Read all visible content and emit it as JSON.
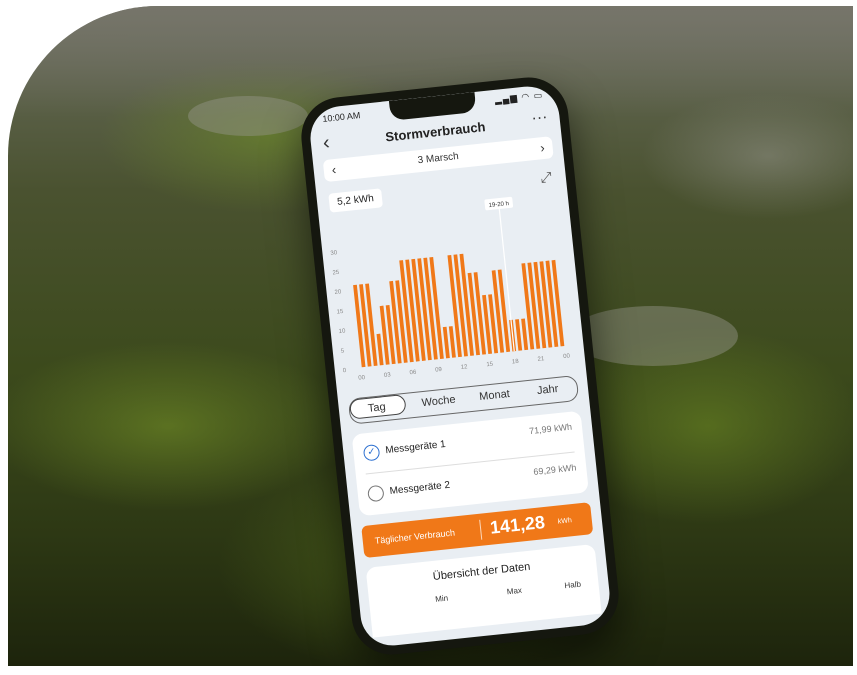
{
  "status": {
    "time": "10:00 AM",
    "icons": "▂▄▆ ◠ ▭"
  },
  "header": {
    "back_icon": "‹",
    "title": "Stormverbrauch",
    "more_icon": "···"
  },
  "date_nav": {
    "prev_icon": "‹",
    "date": "3 Marsch",
    "next_icon": "›"
  },
  "selected_value": "5,2 kWh",
  "expand_icon": "⤢",
  "chart_data": {
    "type": "bar",
    "tooltip": "19-20 h",
    "y_ticks": [
      "0",
      "5",
      "10",
      "15",
      "20",
      "25",
      "30"
    ],
    "x_ticks": [
      "00",
      "03",
      "06",
      "09",
      "12",
      "15",
      "18",
      "21",
      "00"
    ],
    "ylim": [
      0,
      30
    ],
    "values": [
      21,
      21,
      21,
      8,
      15,
      15,
      21,
      21,
      26,
      26,
      26,
      26,
      26,
      26,
      8,
      8,
      26,
      26,
      26,
      21,
      21,
      15,
      15,
      21,
      21,
      8,
      8,
      8,
      22,
      22,
      22,
      22,
      22,
      22
    ],
    "bar_color": "#f07818"
  },
  "tabs": {
    "day": "Tag",
    "week": "Woche",
    "month": "Monat",
    "year": "Jahr"
  },
  "meters": [
    {
      "name": "Messgeräte 1",
      "value": "71,99 kWh",
      "checked": true
    },
    {
      "name": "Messgeräte 2",
      "value": "69,29 kWh",
      "checked": false
    }
  ],
  "daily": {
    "label": "Täglicher Verbrauch",
    "value": "141,28",
    "unit": "kWh"
  },
  "overview": {
    "title": "Übersicht der Daten",
    "min": "Min",
    "max": "Max",
    "half": "Halb"
  },
  "accent_color": "#f07818"
}
